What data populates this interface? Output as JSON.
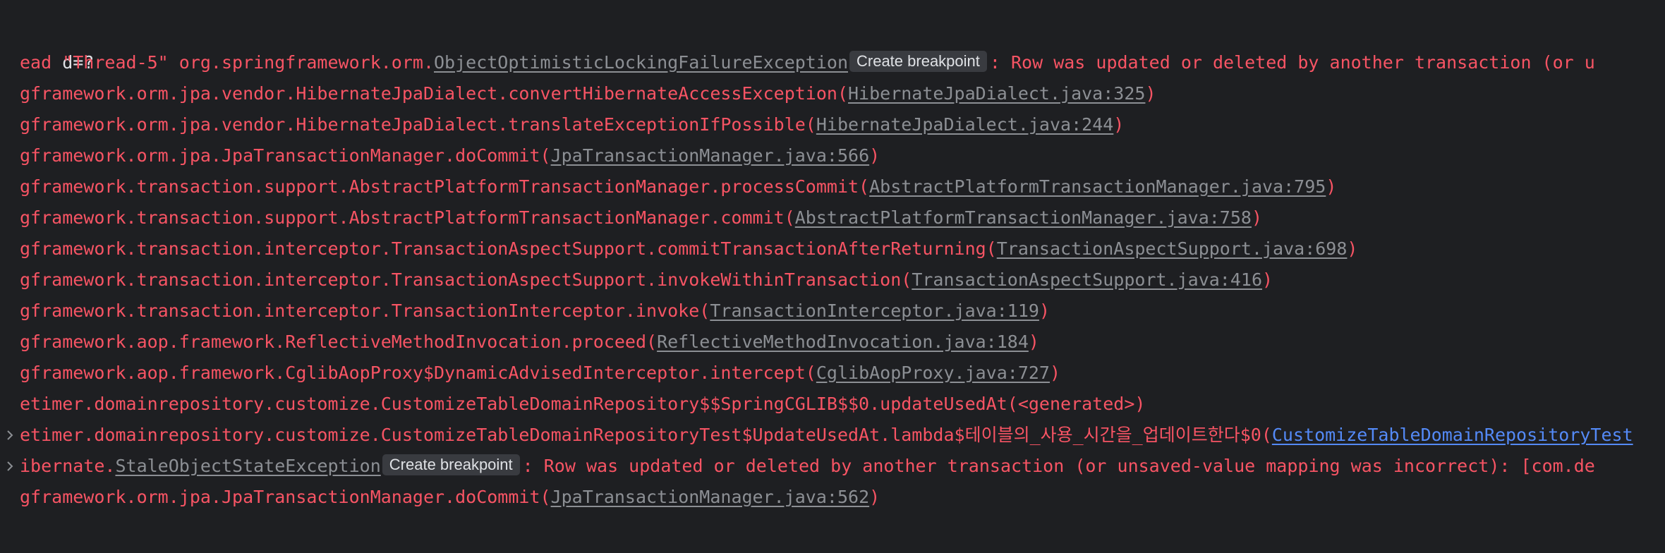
{
  "console": {
    "line0": "d=?",
    "line1": {
      "prefix": "ead \"Thread-5\" org.springframework.orm.",
      "link": "ObjectOptimisticLockingFailureException",
      "breakpoint": "Create breakpoint",
      "suffix": ": Row was updated or deleted by another transaction (or u"
    },
    "line2": {
      "prefix": "gframework.orm.jpa.vendor.HibernateJpaDialect.convertHibernateAccessException(",
      "link": "HibernateJpaDialect.java:325",
      "suffix": ")"
    },
    "line3": {
      "prefix": "gframework.orm.jpa.vendor.HibernateJpaDialect.translateExceptionIfPossible(",
      "link": "HibernateJpaDialect.java:244",
      "suffix": ")"
    },
    "line4": {
      "prefix": "gframework.orm.jpa.JpaTransactionManager.doCommit(",
      "link": "JpaTransactionManager.java:566",
      "suffix": ")"
    },
    "line5": {
      "prefix": "gframework.transaction.support.AbstractPlatformTransactionManager.processCommit(",
      "link": "AbstractPlatformTransactionManager.java:795",
      "suffix": ")"
    },
    "line6": {
      "prefix": "gframework.transaction.support.AbstractPlatformTransactionManager.commit(",
      "link": "AbstractPlatformTransactionManager.java:758",
      "suffix": ")"
    },
    "line7": {
      "prefix": "gframework.transaction.interceptor.TransactionAspectSupport.commitTransactionAfterReturning(",
      "link": "TransactionAspectSupport.java:698",
      "suffix": ")"
    },
    "line8": {
      "prefix": "gframework.transaction.interceptor.TransactionAspectSupport.invokeWithinTransaction(",
      "link": "TransactionAspectSupport.java:416",
      "suffix": ")"
    },
    "line9": {
      "prefix": "gframework.transaction.interceptor.TransactionInterceptor.invoke(",
      "link": "TransactionInterceptor.java:119",
      "suffix": ")"
    },
    "line10": {
      "prefix": "gframework.aop.framework.ReflectiveMethodInvocation.proceed(",
      "link": "ReflectiveMethodInvocation.java:184",
      "suffix": ")"
    },
    "line11": {
      "prefix": "gframework.aop.framework.CglibAopProxy$DynamicAdvisedInterceptor.intercept(",
      "link": "CglibAopProxy.java:727",
      "suffix": ")"
    },
    "line12": "etimer.domainrepository.customize.CustomizeTableDomainRepository$$SpringCGLIB$$0.updateUsedAt(<generated>)",
    "line13": {
      "prefix": "etimer.domainrepository.customize.CustomizeTableDomainRepositoryTest$UpdateUsedAt.lambda$테이블의_사용_시간을_업데이트한다$0(",
      "link": "CustomizeTableDomainRepositoryTest"
    },
    "line14": {
      "prefix": "ibernate.",
      "link": "StaleObjectStateException",
      "breakpoint": "Create breakpoint",
      "suffix": ": Row was updated or deleted by another transaction (or unsaved-value mapping was incorrect): [com.de"
    },
    "line15": {
      "prefix": "gframework.orm.jpa.JpaTransactionManager.doCommit(",
      "link": "JpaTransactionManager.java:562",
      "suffix": ")"
    }
  },
  "colors": {
    "background": "#1e1f22",
    "error_text": "#f75464",
    "plain_text": "#dfe1e5",
    "link_gray": "#8c8f94",
    "link_blue": "#548af7",
    "breakpoint_bg": "#393b40"
  },
  "icons": {
    "expand": "chevron-right-icon"
  }
}
